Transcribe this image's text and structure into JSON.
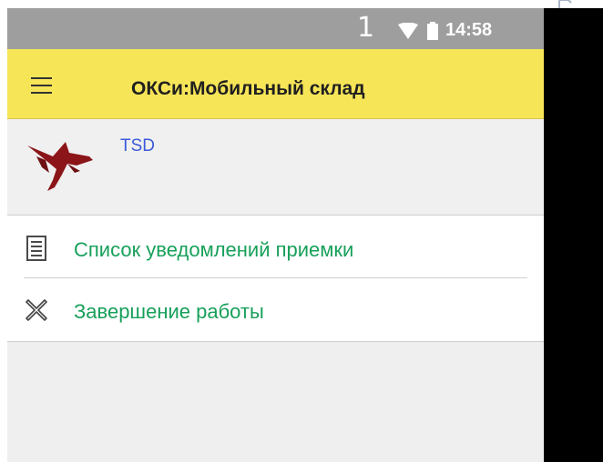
{
  "status_bar": {
    "notification_count": "1",
    "time": "14:58",
    "icons": [
      "wifi-icon",
      "battery-icon"
    ]
  },
  "app_bar": {
    "title": "ОКСи:Мобильный склад",
    "menu_icon": "hamburger-menu-icon"
  },
  "user": {
    "name": "TSD",
    "logo": "red-bird-logo"
  },
  "menu": {
    "items": [
      {
        "label": "Список уведомлений приемки",
        "icon": "document-list-icon"
      },
      {
        "label": "Завершение работы",
        "icon": "close-x-icon"
      }
    ]
  },
  "colors": {
    "status_bar": "#9e9e9e",
    "app_bar": "#f7e558",
    "menu_text": "#17a05a",
    "user_name": "#3b5bd8",
    "logo": "#8b1518"
  }
}
